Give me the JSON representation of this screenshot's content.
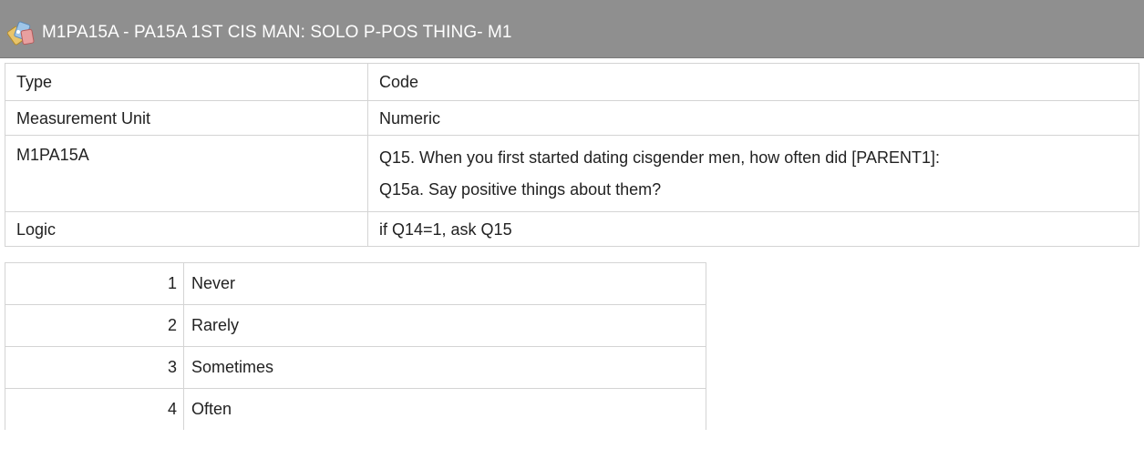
{
  "header": {
    "icon": "variable-tag-icon",
    "title": "M1PA15A - PA15A 1ST CIS MAN: SOLO P-POS THING- M1"
  },
  "properties": [
    {
      "key": "Type",
      "value_lines": [
        "Code"
      ]
    },
    {
      "key": "Measurement Unit",
      "value_lines": [
        "Numeric"
      ]
    },
    {
      "key": "M1PA15A",
      "value_lines": [
        "Q15. When you first started dating cisgender men, how often did [PARENT1]:",
        "Q15a. Say positive things about them?"
      ]
    },
    {
      "key": "Logic",
      "value_lines": [
        "if Q14=1, ask Q15"
      ]
    }
  ],
  "codes": [
    {
      "value": "1",
      "label": "Never"
    },
    {
      "value": "2",
      "label": "Rarely"
    },
    {
      "value": "3",
      "label": "Sometimes"
    },
    {
      "value": "4",
      "label": "Often"
    }
  ],
  "colors": {
    "header_bg": "#8f8f8f",
    "header_text": "#ffffff",
    "border": "#d4d4d4",
    "text": "#222222"
  }
}
